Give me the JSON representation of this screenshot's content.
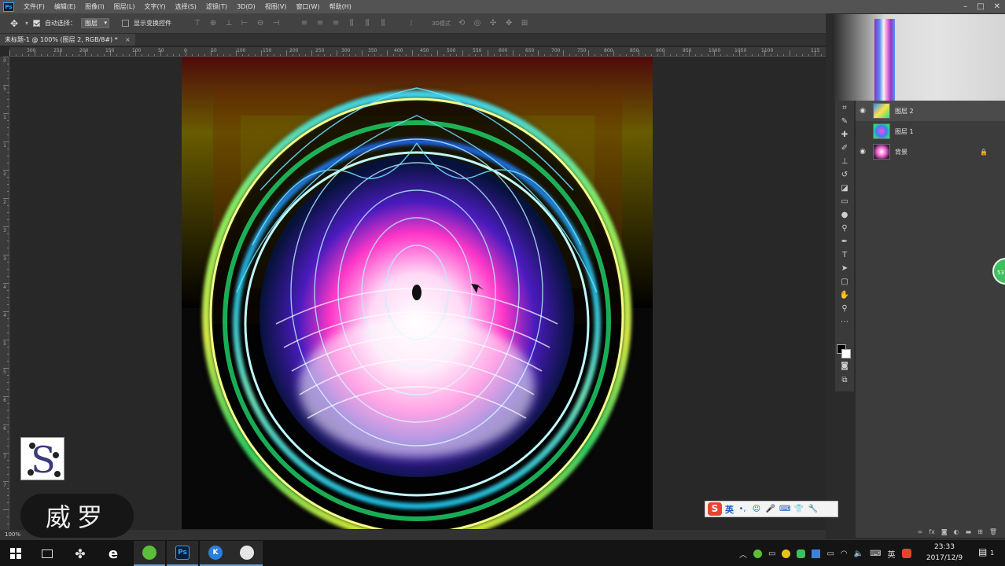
{
  "menubar": {
    "items": [
      "文件(F)",
      "编辑(E)",
      "图像(I)",
      "图层(L)",
      "文字(Y)",
      "选择(S)",
      "滤镜(T)",
      "3D(D)",
      "视图(V)",
      "窗口(W)",
      "帮助(H)"
    ],
    "logo_text": "Ps",
    "controls": [
      "–",
      "□",
      "✕"
    ]
  },
  "options": {
    "auto_select_label": "自动选择：",
    "auto_select_value": "图层",
    "show_transform_label": "显示变换控件"
  },
  "document": {
    "tab_title": "未标题-1 @ 100% (图层 2, RGB/8#) *",
    "tab_close": "×",
    "zoom": "100%"
  },
  "rulers": {
    "top": [
      "300",
      "250",
      "200",
      "150",
      "100",
      "50",
      "0",
      "50",
      "100",
      "150",
      "200",
      "250",
      "300",
      "350",
      "400",
      "450",
      "500",
      "550",
      "600",
      "650",
      "700",
      "750",
      "800",
      "850",
      "900",
      "950",
      "1000",
      "1050",
      "1100",
      "115"
    ],
    "left": [
      "0",
      "5",
      "1",
      "1",
      "2",
      "2",
      "3",
      "3",
      "4",
      "4",
      "5",
      "5",
      "6",
      "6",
      "7",
      "7"
    ]
  },
  "layers": [
    {
      "name": "图层 2",
      "visible": true,
      "selected": true
    },
    {
      "name": "图层 1",
      "visible": false,
      "selected": false
    },
    {
      "name": "背景",
      "visible": true,
      "selected": false,
      "locked": true
    }
  ],
  "tools": [
    "crop-icon",
    "eyedropper-icon",
    "healing-icon",
    "brush-icon",
    "stamp-icon",
    "history-brush-icon",
    "eraser-icon",
    "gradient-icon",
    "blur-icon",
    "dodge-icon",
    "pen-icon",
    "type-icon",
    "path-select-icon",
    "shape-icon",
    "hand-icon",
    "zoom-icon",
    "more-icon"
  ],
  "tool_glyphs": {
    "type": "T"
  },
  "ime": {
    "logo": "S",
    "lang": "英",
    "buttons": [
      "•,",
      "☺",
      "🎤",
      "⌨",
      "👕",
      "🔧"
    ]
  },
  "side_badge": "53",
  "watermark": {
    "logo_letter": "S",
    "label": "威罗"
  },
  "taskbar": {
    "apps": [
      "start-icon",
      "task-view-icon",
      "fan-icon",
      "ie-icon",
      "browser-icon",
      "photoshop-icon",
      "kk-icon",
      "qq-icon"
    ],
    "ps_label": "Ps",
    "kk_label": "K",
    "ie_label": "e",
    "tray_lang": "英",
    "time": "23:33",
    "date": "2017/12/9",
    "notif_count": "1"
  },
  "colors": {
    "ps_blue": "#2fa3f7",
    "panel": "#3c3c3c",
    "workspace": "#282828",
    "ime_red": "#e8432e",
    "badge_green": "#3fbf5f"
  }
}
